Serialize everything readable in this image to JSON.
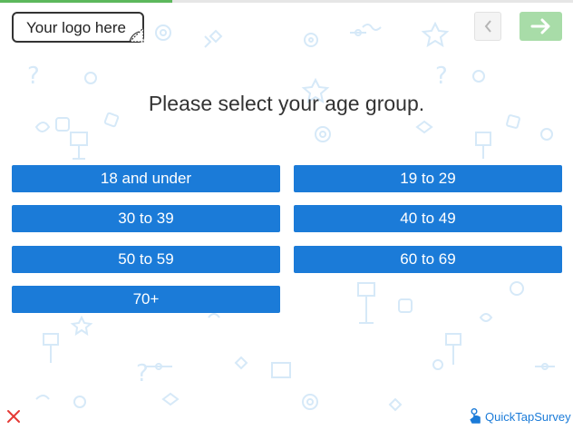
{
  "header": {
    "logo_placeholder": "Your logo here",
    "progress_percent": 30
  },
  "question": {
    "text": "Please select your age group."
  },
  "options": [
    {
      "label": "18 and under"
    },
    {
      "label": "19 to 29"
    },
    {
      "label": "30 to 39"
    },
    {
      "label": "40 to 49"
    },
    {
      "label": "50 to 59"
    },
    {
      "label": "60 to 69"
    },
    {
      "label": "70+"
    }
  ],
  "footer": {
    "brand": "QuickTapSurvey"
  },
  "colors": {
    "option_bg": "#1b7bd8",
    "progress": "#5cb85c",
    "next_button": "#a8dca8",
    "pattern": "#d6e9f8"
  }
}
